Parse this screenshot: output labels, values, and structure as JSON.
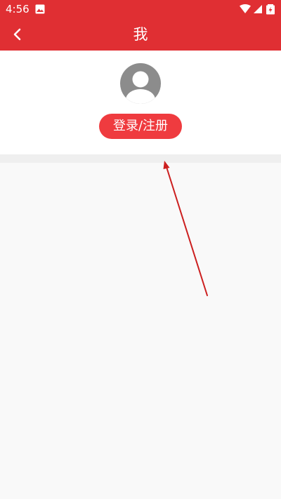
{
  "status_bar": {
    "time": "4:56",
    "icons": [
      "image-icon",
      "wifi-icon",
      "signal-icon",
      "battery-charging-icon"
    ]
  },
  "app_bar": {
    "title": "我",
    "back_icon": "chevron-left-icon"
  },
  "profile": {
    "avatar_icon": "user-avatar-icon",
    "login_button_label": "登录/注册"
  },
  "colors": {
    "brand_red": "#e02f33",
    "button_red": "#ef3b3f",
    "background": "#f9f9f9",
    "divider": "#efefef",
    "avatar_gray": "#8c8c8c",
    "annotation_arrow": "#cc1f1f"
  }
}
